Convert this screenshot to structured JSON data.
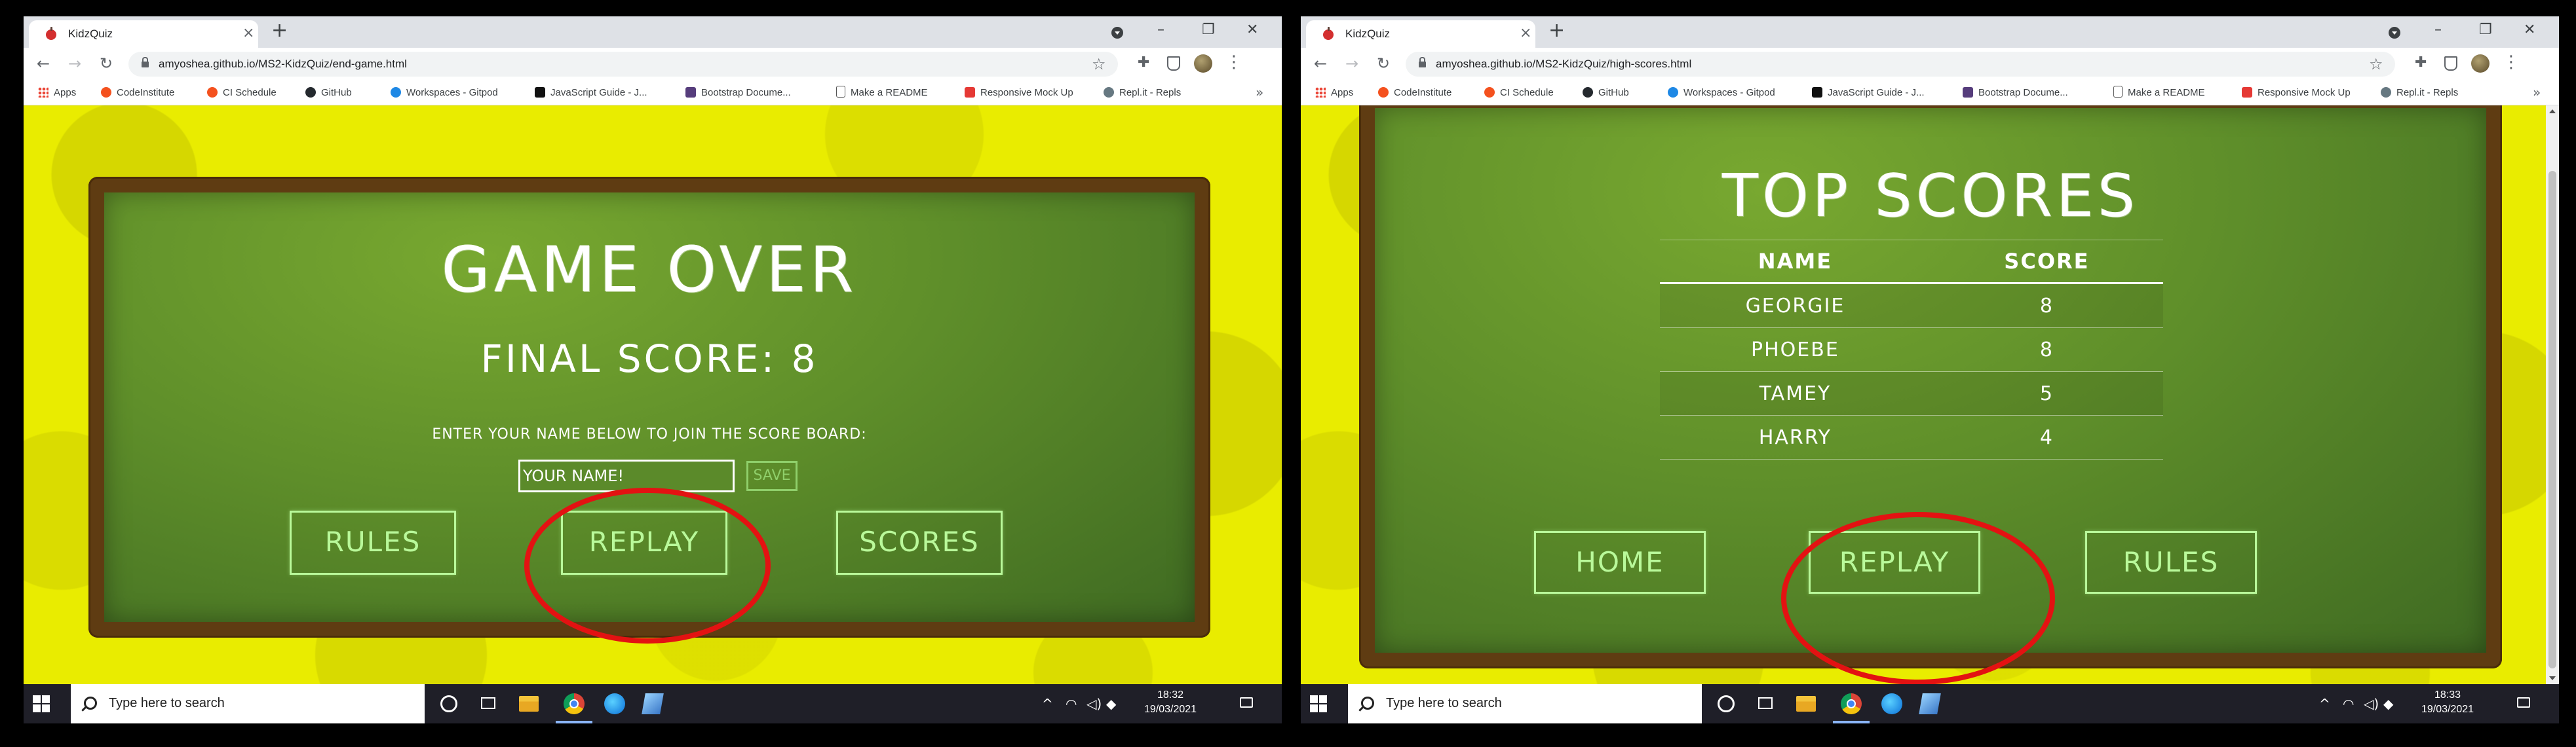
{
  "left": {
    "tab_title": "KidzQuiz",
    "url": "amyoshea.github.io/MS2-KidzQuiz/end-game.html",
    "page": {
      "title": "GAME OVER",
      "final_score": "FINAL SCORE: 8",
      "join_prompt": "ENTER YOUR NAME BELOW TO JOIN THE SCORE BOARD:",
      "name_input": {
        "placeholder": "YOUR NAME!",
        "value": ""
      },
      "save_label": "SAVE",
      "buttons": [
        "RULES",
        "REPLAY",
        "SCORES"
      ]
    },
    "clock_time": "18:32",
    "clock_date": "19/03/2021"
  },
  "right": {
    "tab_title": "KidzQuiz",
    "url": "amyoshea.github.io/MS2-KidzQuiz/high-scores.html",
    "page": {
      "title": "TOP SCORES",
      "table_headers": [
        "NAME",
        "SCORE"
      ],
      "rows": [
        {
          "name": "GEORGIE",
          "score": "8"
        },
        {
          "name": "PHOEBE",
          "score": "8"
        },
        {
          "name": "TAMEY",
          "score": "5"
        },
        {
          "name": "HARRY",
          "score": "4"
        }
      ],
      "buttons": [
        "HOME",
        "REPLAY",
        "RULES"
      ]
    },
    "clock_time": "18:33",
    "clock_date": "19/03/2021"
  },
  "bookmarks": [
    "Apps",
    "CodeInstitute",
    "CI Schedule",
    "GitHub",
    "Workspaces - Gitpod",
    "JavaScript Guide - J...",
    "Bootstrap Docume...",
    "Make a README",
    "Responsive Mock Up",
    "Repl.it - Repls"
  ],
  "bookmark_more": "»",
  "taskbar": {
    "search_placeholder": "Type here to search"
  },
  "colors": {
    "page_background": "#e9ec00",
    "board_frame": "#5f3c12",
    "board_green": "#5f8f2a",
    "chalk_button": "#b9f99a",
    "highlight_circle": "#e31212"
  },
  "icons": {
    "tab_favicon": "apple-icon",
    "new_tab": "plus-icon",
    "lock": "lock-icon",
    "bookmark_star": "star-icon",
    "extensions": "puzzle-icon",
    "start": "windows-logo-icon",
    "search": "search-icon"
  }
}
